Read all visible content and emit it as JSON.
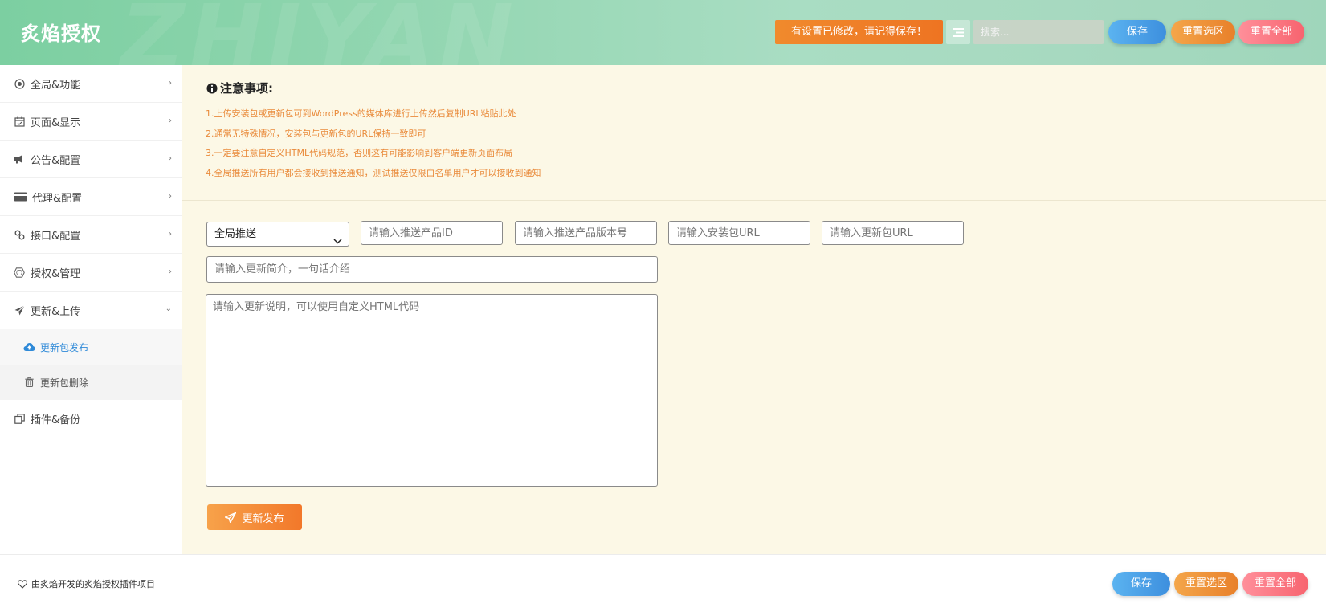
{
  "header": {
    "brand": "炙焰授权",
    "watermark": "ZHIYAN",
    "modified_notice": "有设置已修改，请记得保存！",
    "search_placeholder": "搜索...",
    "save_label": "保存",
    "reset_section_label": "重置选区",
    "reset_all_label": "重置全部"
  },
  "sidebar": {
    "items": [
      {
        "label": "全局&功能",
        "icon": "target-icon"
      },
      {
        "label": "页面&显示",
        "icon": "calendar-check-icon"
      },
      {
        "label": "公告&配置",
        "icon": "megaphone-icon"
      },
      {
        "label": "代理&配置",
        "icon": "credit-card-icon"
      },
      {
        "label": "接口&配置",
        "icon": "link-icon"
      },
      {
        "label": "授权&管理",
        "icon": "hexagon-icon"
      },
      {
        "label": "更新&上传",
        "icon": "paper-plane-icon"
      },
      {
        "label": "插件&备份",
        "icon": "copy-icon"
      }
    ],
    "sub_items": [
      {
        "label": "更新包发布",
        "icon": "cloud-upload-icon",
        "active": true
      },
      {
        "label": "更新包删除",
        "icon": "trash-icon",
        "active": false
      }
    ]
  },
  "main": {
    "notice_title": "注意事项:",
    "notices": [
      "1.上传安装包或更新包可到WordPress的媒体库进行上传然后复制URL粘贴此处",
      "2.通常无特殊情况，安装包与更新包的URL保持一致即可",
      "3.一定要注意自定义HTML代码规范，否则这有可能影响到客户端更新页面布局",
      "4.全局推送所有用户都会接收到推送通知，测试推送仅限白名单用户才可以接收到通知"
    ],
    "push_type": "全局推送",
    "product_id_placeholder": "请输入推送产品ID",
    "version_placeholder": "请输入推送产品版本号",
    "install_url_placeholder": "请输入安装包URL",
    "update_url_placeholder": "请输入更新包URL",
    "summary_placeholder": "请输入更新简介，一句话介绍",
    "description_placeholder": "请输入更新说明，可以使用自定义HTML代码",
    "publish_label": "更新发布"
  },
  "footer": {
    "note": "由炙焰开发的炙焰授权插件项目",
    "save_label": "保存",
    "reset_section_label": "重置选区",
    "reset_all_label": "重置全部"
  },
  "colors": {
    "header_green": "#95d7b3",
    "notice_orange": "#e98a3a",
    "main_bg": "#fcf8e6",
    "active_blue": "#2f8ad8"
  }
}
